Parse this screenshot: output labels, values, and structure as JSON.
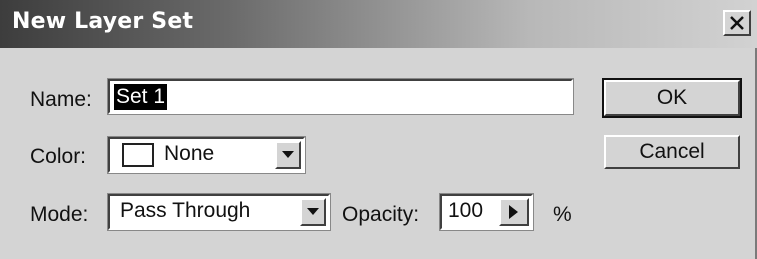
{
  "window": {
    "title": "New Layer Set"
  },
  "fields": {
    "name_label": "Name:",
    "name_value": "Set 1",
    "color_label": "Color:",
    "color_value": "None",
    "mode_label": "Mode:",
    "mode_value": "Pass Through",
    "opacity_label": "Opacity:",
    "opacity_value": "100",
    "opacity_unit": "%"
  },
  "buttons": {
    "ok": "OK",
    "cancel": "Cancel",
    "close": "×"
  },
  "icons": {
    "close": "close-icon",
    "dropdown": "chevron-down-icon",
    "slider": "triangle-right-icon"
  },
  "colors": {
    "dialog_bg": "#d4d4d4",
    "title_dark": "#3d3d3d",
    "swatch": "#ffffff"
  }
}
